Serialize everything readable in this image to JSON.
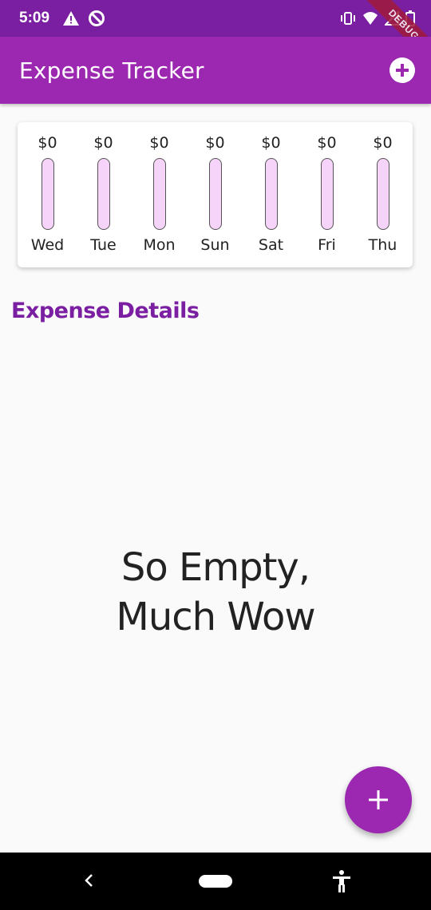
{
  "status_bar": {
    "time": "5:09",
    "debug_label": "DEBUG"
  },
  "app_bar": {
    "title": "Expense Tracker"
  },
  "chart_data": {
    "type": "bar",
    "categories": [
      "Wed",
      "Tue",
      "Mon",
      "Sun",
      "Sat",
      "Fri",
      "Thu"
    ],
    "value_labels": [
      "$0",
      "$0",
      "$0",
      "$0",
      "$0",
      "$0",
      "$0"
    ],
    "values": [
      0,
      0,
      0,
      0,
      0,
      0,
      0
    ],
    "title": "",
    "xlabel": "",
    "ylabel": ""
  },
  "section": {
    "title": "Expense Details"
  },
  "empty_state": {
    "line1": "So Empty,",
    "line2": "Much Wow"
  },
  "fab": {
    "icon": "plus-icon",
    "glyph": "+"
  },
  "colors": {
    "primary": "#9c27b0",
    "primary_dark": "#7b1fa2",
    "bar_track": "#f6d3f8"
  }
}
